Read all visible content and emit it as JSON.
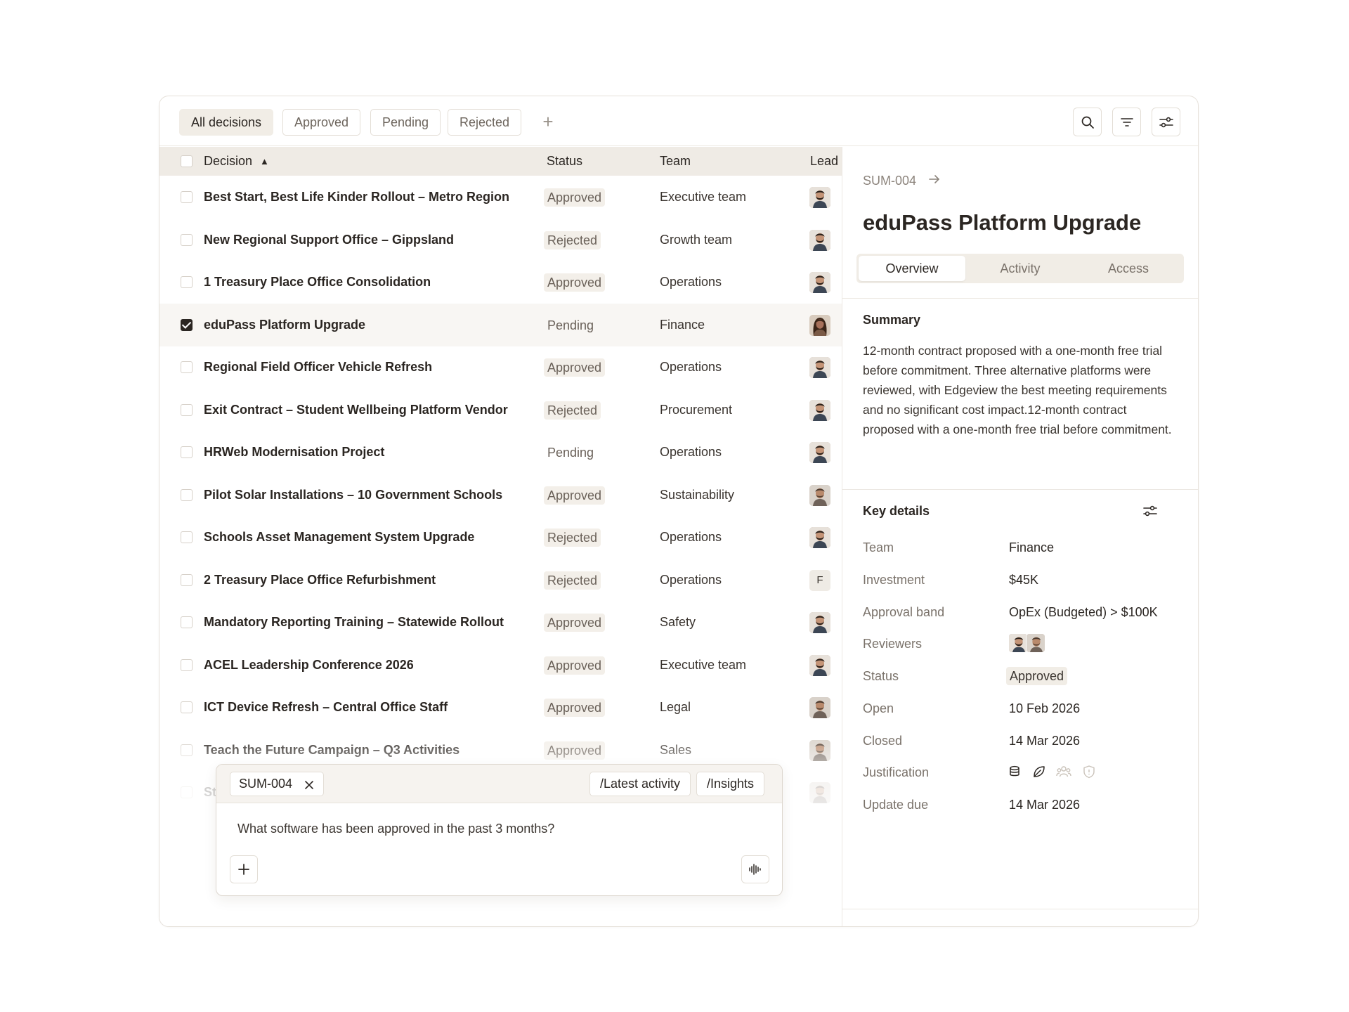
{
  "tabs": [
    {
      "label": "All decisions",
      "active": true
    },
    {
      "label": "Approved",
      "active": false
    },
    {
      "label": "Pending",
      "active": false
    },
    {
      "label": "Rejected",
      "active": false
    }
  ],
  "toolbar": {
    "add_tab": "+",
    "search_icon": "search-icon",
    "filter_icon": "filter-icon",
    "settings_icon": "sliders-icon"
  },
  "table": {
    "headers": {
      "decision": "Decision",
      "sort_indicator": "▲",
      "status": "Status",
      "team": "Team",
      "lead": "Lead"
    },
    "rows": [
      {
        "name": "Best Start, Best Life Kinder Rollout – Metro Region",
        "status": "Approved",
        "team": "Executive team",
        "lead": "avatar-man-beard"
      },
      {
        "name": "New Regional Support Office – Gippsland",
        "status": "Rejected",
        "team": "Growth team",
        "lead": "avatar-man-beard"
      },
      {
        "name": "1 Treasury Place Office Consolidation",
        "status": "Approved",
        "team": "Operations",
        "lead": "avatar-man-beard"
      },
      {
        "name": "eduPass Platform Upgrade",
        "status": "Pending",
        "team": "Finance",
        "lead": "avatar-woman",
        "selected": true
      },
      {
        "name": "Regional Field Officer Vehicle Refresh",
        "status": "Approved",
        "team": "Operations",
        "lead": "avatar-man-beard"
      },
      {
        "name": "Exit Contract – Student Wellbeing Platform Vendor",
        "status": "Rejected",
        "team": "Procurement",
        "lead": "avatar-man-beard"
      },
      {
        "name": "HRWeb Modernisation Project",
        "status": "Pending",
        "team": "Operations",
        "lead": "avatar-man-beard"
      },
      {
        "name": "Pilot Solar Installations – 10 Government Schools",
        "status": "Approved",
        "team": "Sustainability",
        "lead": "avatar-man-2"
      },
      {
        "name": "Schools Asset Management System Upgrade",
        "status": "Rejected",
        "team": "Operations",
        "lead": "avatar-man-beard"
      },
      {
        "name": "2 Treasury Place Office Refurbishment",
        "status": "Rejected",
        "team": "Operations",
        "lead": "F"
      },
      {
        "name": "Mandatory Reporting Training – Statewide Rollout",
        "status": "Approved",
        "team": "Safety",
        "lead": "avatar-man-beard"
      },
      {
        "name": "ACEL Leadership Conference 2026",
        "status": "Approved",
        "team": "Executive team",
        "lead": "avatar-man-beard"
      },
      {
        "name": "ICT Device Refresh – Central Office Staff",
        "status": "Approved",
        "team": "Legal",
        "lead": "avatar-man-2"
      },
      {
        "name": "Teach the Future Campaign – Q3 Activities",
        "status": "Approved",
        "team": "Sales",
        "lead": "avatar-man-2"
      },
      {
        "name": "St",
        "status": "",
        "team": "",
        "lead": "avatar-man-2"
      }
    ]
  },
  "panel": {
    "ref": "SUM-004",
    "title": "eduPass Platform Upgrade",
    "tabs": [
      "Overview",
      "Activity",
      "Access"
    ],
    "summary_title": "Summary",
    "summary": "12-month contract proposed with a one-month free trial before commitment. Three alternative platforms were reviewed, with Edgeview the best meeting requirements and no significant cost impact.12-month contract proposed with a one-month free trial before commitment.",
    "key_details_title": "Key details",
    "details": {
      "team_label": "Team",
      "team": "Finance",
      "investment_label": "Investment",
      "investment": "$45K",
      "band_label": "Approval band",
      "band": "OpEx (Budgeted) > $100K",
      "reviewers_label": "Reviewers",
      "status_label": "Status",
      "status": "Approved",
      "open_label": "Open",
      "open": "10 Feb 2026",
      "closed_label": "Closed",
      "closed": "14 Mar 2026",
      "justification_label": "Justification",
      "justification_icons": [
        "coins-icon",
        "leaf-icon",
        "people-icon",
        "shield-icon"
      ],
      "update_label": "Update due",
      "update": "14 Mar 2026"
    }
  },
  "chat": {
    "context_chip": "SUM-004",
    "commands": [
      "/Latest activity",
      "/Insights"
    ],
    "input_value": "What software has been approved in the past 3 months?",
    "add_icon": "plus-icon",
    "voice_icon": "waveform-icon"
  }
}
